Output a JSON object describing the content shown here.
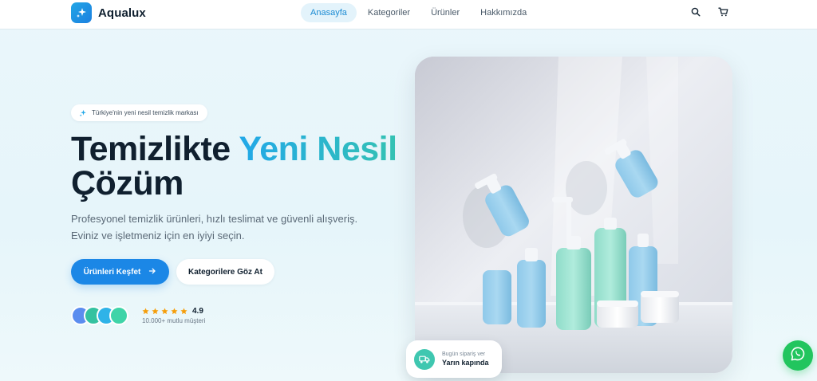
{
  "header": {
    "brand": "Aqualux",
    "nav": [
      {
        "label": "Anasayfa",
        "active": true
      },
      {
        "label": "Kategoriler",
        "active": false
      },
      {
        "label": "Ürünler",
        "active": false
      },
      {
        "label": "Hakkımızda",
        "active": false
      }
    ],
    "icons": [
      "search-icon",
      "cart-icon"
    ]
  },
  "hero": {
    "badge": "Türkiye'nin yeni nesil temizlik markası",
    "headline_part1": "Temizlikte ",
    "headline_highlight": "Yeni Nesil",
    "headline_part2": "Çözüm",
    "subtitle_line1": "Profesyonel temizlik ürünleri, hızlı teslimat ve güvenli alışveriş.",
    "subtitle_line2": "Eviniz ve işletmeniz için en iyiyi seçin.",
    "primary_button": "Ürünleri Keşfet",
    "secondary_button": "Kategorilere Göz At",
    "rating": {
      "value": "4.9",
      "stars": 5,
      "customers": "10.000+ mutlu müşteri"
    },
    "avatar_colors": [
      "#5b8def",
      "#34c2a0",
      "#2fb3e8",
      "#3fd4a8"
    ]
  },
  "delivery": {
    "label": "Bugün sipariş ver",
    "value": "Yarın kapında"
  },
  "colors": {
    "primary": "#1b87e6",
    "accent_teal": "#34c2b3",
    "whatsapp": "#22c55e",
    "star": "#f59e0b"
  }
}
